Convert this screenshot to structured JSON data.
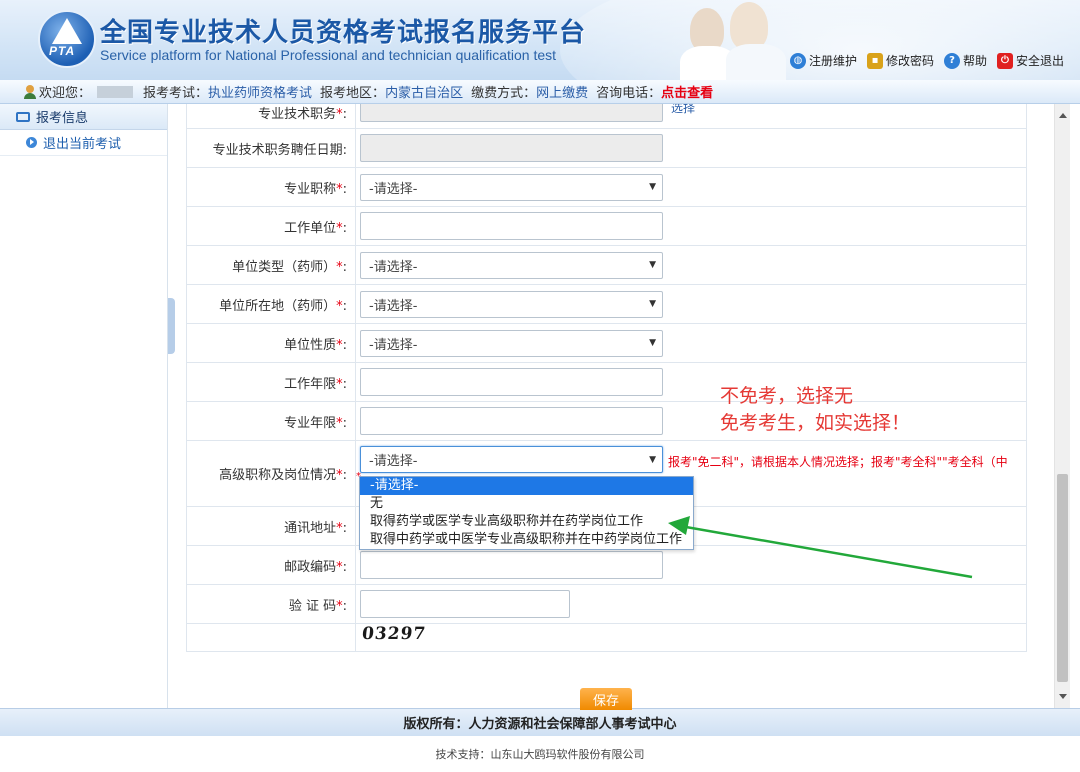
{
  "header": {
    "logo_text": "PTA",
    "title": "全国专业技术人员资格考试报名服务平台",
    "subtitle": "Service platform for National Professional and technician qualification test",
    "links": [
      {
        "label": "注册维护",
        "icon": "globe-icon",
        "color": "#2f7fd6"
      },
      {
        "label": "修改密码",
        "icon": "lock-icon",
        "color": "#d9a21a"
      },
      {
        "label": "帮助",
        "icon": "help-icon",
        "color": "#2f7fd6"
      },
      {
        "label": "安全退出",
        "icon": "power-icon",
        "color": "#e02020"
      }
    ]
  },
  "infobar": {
    "welcome_label": "欢迎您：",
    "exam_label": "报考考试：",
    "exam_value": "执业药师资格考试",
    "region_label": "报考地区：",
    "region_value": "内蒙古自治区",
    "pay_label": "缴费方式：",
    "pay_value": "网上缴费",
    "phone_label": "咨询电话：",
    "phone_link": "点击查看"
  },
  "sidebar": {
    "header": "报考信息",
    "items": [
      {
        "label": "退出当前考试"
      }
    ]
  },
  "form": {
    "required_mark": "*",
    "colon": ":",
    "rows": [
      {
        "label": "专业技术职务",
        "type": "input-gray",
        "link": "选择"
      },
      {
        "label": "专业技术职务聘任日期",
        "type": "input-gray"
      },
      {
        "label": "专业职称",
        "type": "select",
        "value": "-请选择-"
      },
      {
        "label": "工作单位",
        "type": "input"
      },
      {
        "label": "单位类型（药师）",
        "type": "select",
        "value": "-请选择-"
      },
      {
        "label": "单位所在地（药师）",
        "type": "select",
        "value": "-请选择-"
      },
      {
        "label": "单位性质",
        "type": "select",
        "value": "-请选择-"
      },
      {
        "label": "工作年限",
        "type": "input"
      },
      {
        "label": "专业年限",
        "type": "input"
      },
      {
        "label": "高级职称及岗位情况",
        "type": "select",
        "value": "-请选择-",
        "hint": "报考\"免二科\"，请根据本人情况选择；报考\"考全科\"\"考全科（中"
      },
      {
        "label": "通讯地址",
        "type": "input"
      },
      {
        "label": "邮政编码",
        "type": "input"
      },
      {
        "label": "验 证 码",
        "type": "input-short"
      }
    ],
    "captcha": "03297"
  },
  "dropdown": {
    "options": [
      "-请选择-",
      "无",
      "取得药学或医学专业高级职称并在药学岗位工作",
      "取得中药学或中医学专业高级职称并在中药学岗位工作"
    ],
    "selected_index": 0
  },
  "annotation": {
    "line1": "不免考，选择无",
    "line2": "免考考生，如实选择！"
  },
  "save_label": "保存",
  "footer": {
    "copyright": "版权所有：人力资源和社会保障部人事考试中心",
    "support": "技术支持：山东山大鸥玛软件股份有限公司"
  }
}
